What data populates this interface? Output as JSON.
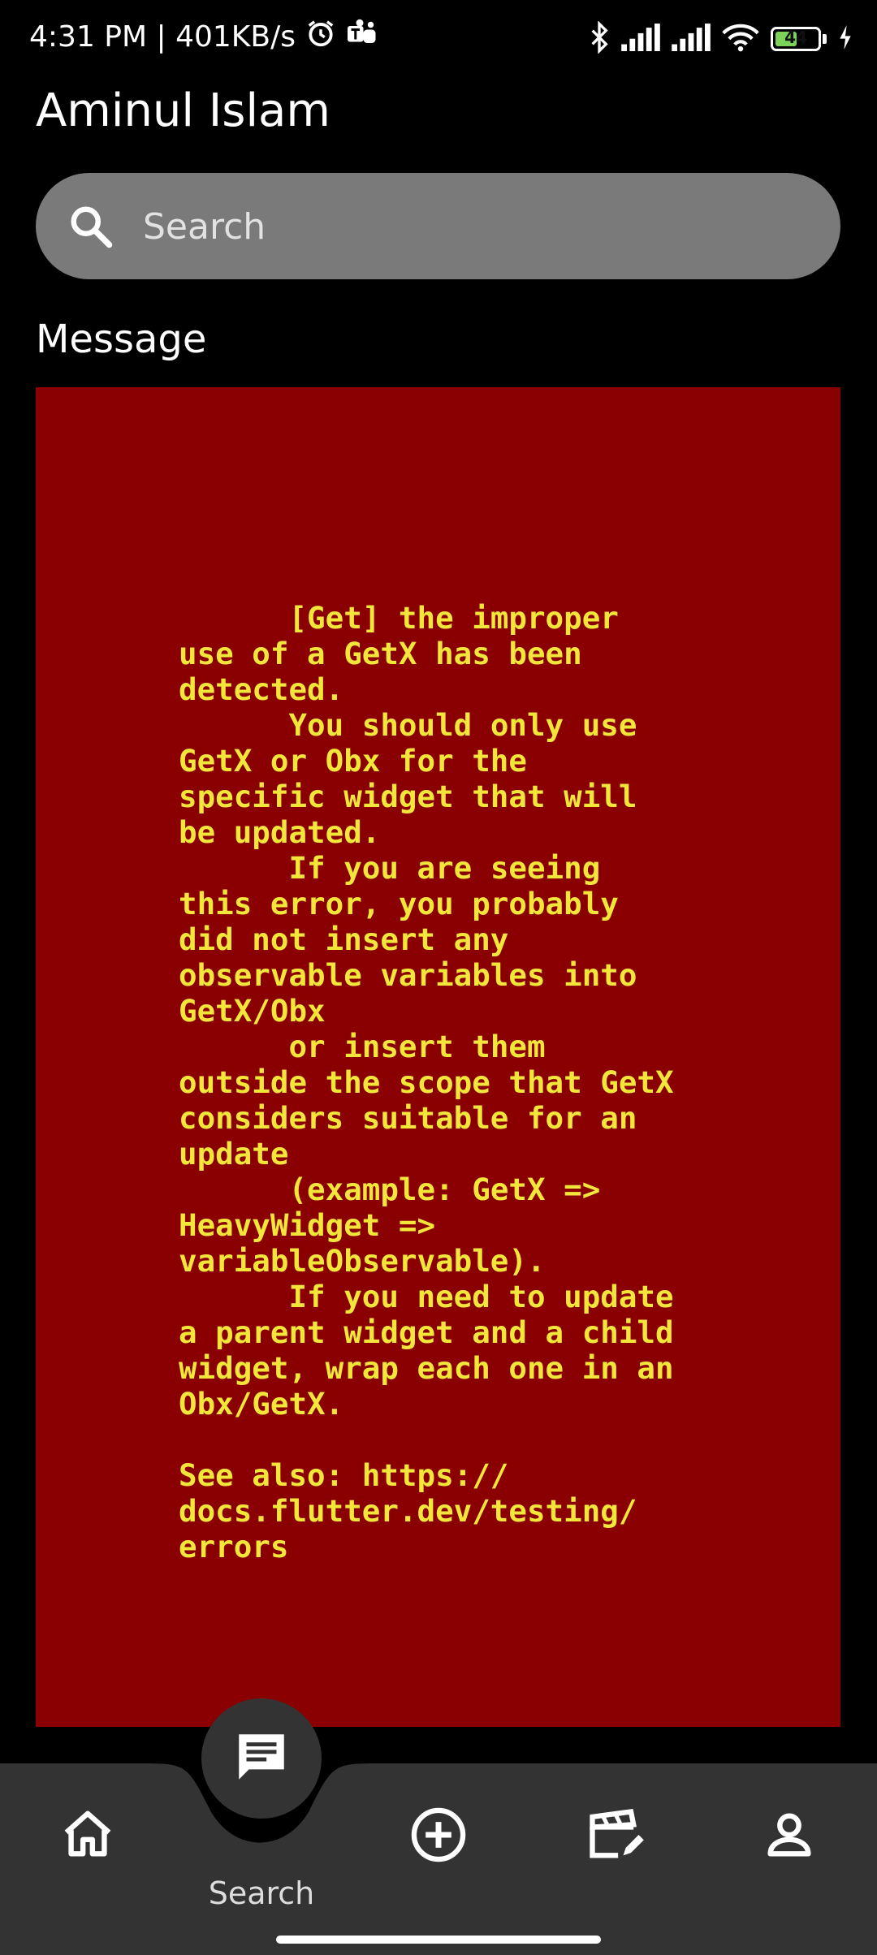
{
  "status_bar": {
    "time_speed": "4:31 PM | 401KB/s",
    "battery": "44",
    "icons": [
      "alarm-icon",
      "teams-icon",
      "bluetooth-icon",
      "signal-icon",
      "signal-icon",
      "wifi-icon",
      "battery-icon",
      "charging-icon"
    ]
  },
  "header": {
    "title": "Aminul Islam"
  },
  "search": {
    "placeholder": "Search"
  },
  "section": {
    "title": "Message"
  },
  "error": {
    "message": "      [Get] the improper\nuse of a GetX has been\ndetected.\n      You should only use\nGetX or Obx for the\nspecific widget that will\nbe updated.\n      If you are seeing\nthis error, you probably\ndid not insert any\nobservable variables into\nGetX/Obx\n      or insert them\noutside the scope that GetX\nconsiders suitable for an\nupdate\n      (example: GetX =>\nHeavyWidget =>\nvariableObservable).\n      If you need to update\na parent widget and a child\nwidget, wrap each one in an\nObx/GetX.\n\nSee also: https://\ndocs.flutter.dev/testing/\nerrors",
    "background": "#8a0000",
    "text_color": "#f2e63a"
  },
  "bottom_nav": {
    "items": [
      {
        "icon": "home-icon"
      },
      {
        "icon": "message-icon",
        "label": "Search",
        "active": true
      },
      {
        "icon": "add-circle-icon"
      },
      {
        "icon": "clapperboard-edit-icon"
      },
      {
        "icon": "person-icon"
      }
    ]
  }
}
